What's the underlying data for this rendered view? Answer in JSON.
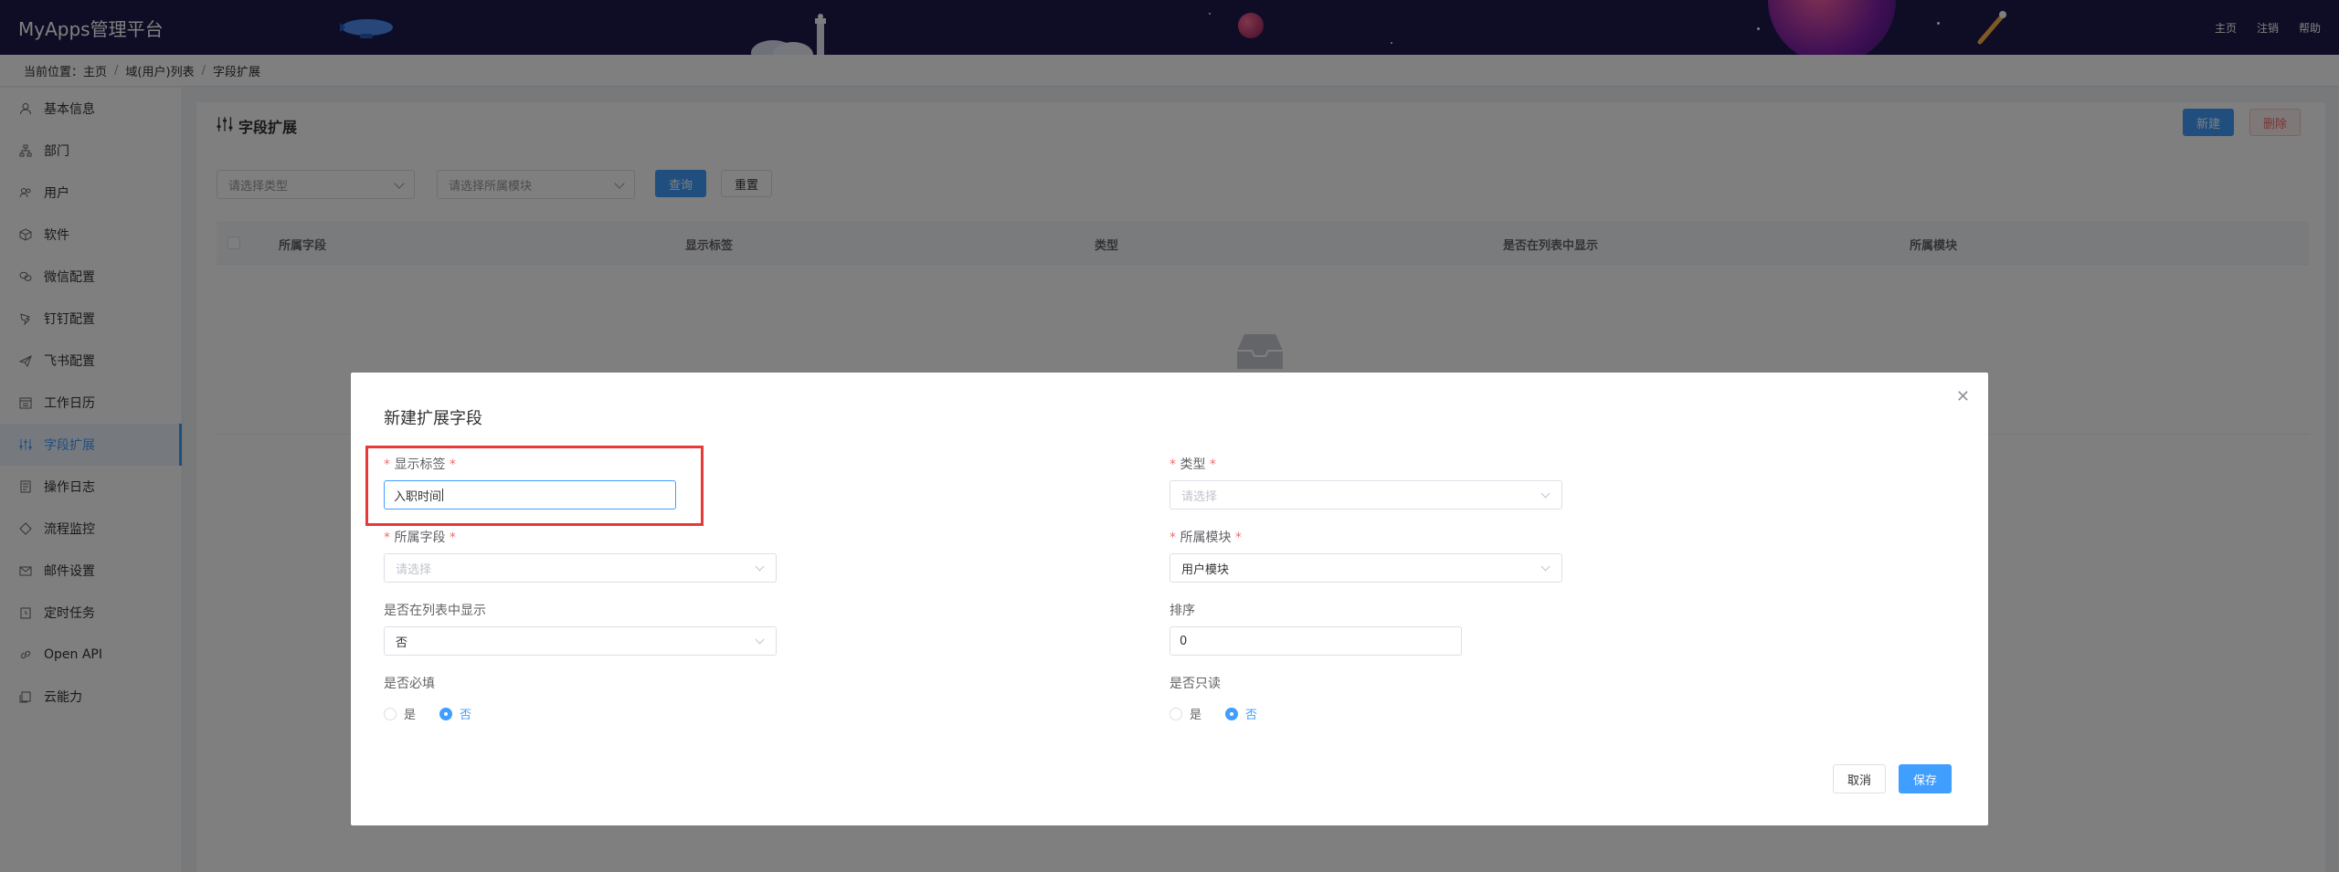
{
  "header": {
    "brand": "MyApps管理平台",
    "nav": [
      "主页",
      "注销",
      "帮助"
    ]
  },
  "breadcrumb": {
    "prefix": "当前位置：",
    "items": [
      "主页",
      "域(用户)列表",
      "字段扩展"
    ]
  },
  "sidebar": {
    "items": [
      {
        "label": "基本信息",
        "icon": "user-icon"
      },
      {
        "label": "部门",
        "icon": "org-icon"
      },
      {
        "label": "用户",
        "icon": "users-icon"
      },
      {
        "label": "软件",
        "icon": "box-icon"
      },
      {
        "label": "微信配置",
        "icon": "wechat-icon"
      },
      {
        "label": "钉钉配置",
        "icon": "dingtalk-icon"
      },
      {
        "label": "飞书配置",
        "icon": "feishu-icon"
      },
      {
        "label": "工作日历",
        "icon": "calendar-icon"
      },
      {
        "label": "字段扩展",
        "icon": "sliders-icon"
      },
      {
        "label": "操作日志",
        "icon": "log-icon"
      },
      {
        "label": "流程监控",
        "icon": "monitor-icon"
      },
      {
        "label": "邮件设置",
        "icon": "mail-icon"
      },
      {
        "label": "定时任务",
        "icon": "timer-icon"
      },
      {
        "label": "Open API",
        "icon": "link-icon"
      },
      {
        "label": "云能力",
        "icon": "cloud-icon"
      }
    ],
    "active_index": 8
  },
  "main": {
    "title": "字段扩展",
    "new_label": "新建",
    "delete_label": "删除",
    "filter_type_placeholder": "请选择类型",
    "filter_module_placeholder": "请选择所属模块",
    "query_label": "查询",
    "reset_label": "重置",
    "columns": [
      "所属字段",
      "显示标签",
      "类型",
      "是否在列表中显示",
      "所属模块"
    ]
  },
  "dialog": {
    "title": "新建扩展字段",
    "display_label": {
      "label": "显示标签",
      "value": "入职时间"
    },
    "type": {
      "label": "类型",
      "placeholder": "请选择"
    },
    "field": {
      "label": "所属字段",
      "placeholder": "请选择"
    },
    "module": {
      "label": "所属模块",
      "value": "用户模块"
    },
    "show_in_list": {
      "label": "是否在列表中显示",
      "value": "否"
    },
    "sort": {
      "label": "排序",
      "value": "0"
    },
    "required": {
      "label": "是否必填",
      "options": [
        "是",
        "否"
      ],
      "selected": "否"
    },
    "readonly": {
      "label": "是否只读",
      "options": [
        "是",
        "否"
      ],
      "selected": "否"
    },
    "cancel_label": "取消",
    "save_label": "保存"
  },
  "colors": {
    "header_bg": "#1e1b4b",
    "primary": "#409eff",
    "danger": "#f56c6c",
    "highlight": "#e5393a"
  }
}
